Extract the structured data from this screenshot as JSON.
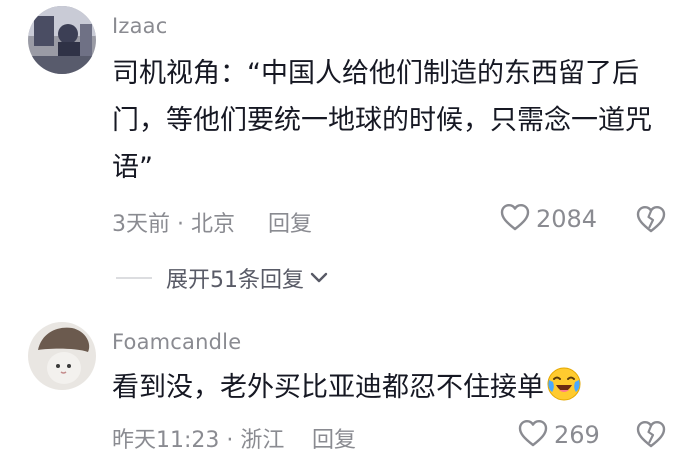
{
  "comments": [
    {
      "username": "Izaac",
      "text": "司机视角：“中国人给他们制造的东西留了后门，等他们要统一地球的时候，只需念一道咒语”",
      "time_location": "3天前 · 北京",
      "reply_label": "回复",
      "likes": "2084",
      "expand_label": "展开51条回复"
    },
    {
      "username": "Foamcandle",
      "text": "看到没，老外买比亚迪都忍不住接单",
      "emoji": "laughing-with-tears-emoji",
      "time_location": "昨天11:23 · 浙江",
      "reply_label": "回复",
      "likes": "269"
    }
  ],
  "colors": {
    "primary_text": "#161823",
    "secondary_text": "#8a8b91",
    "divider": "#dcdde0"
  }
}
